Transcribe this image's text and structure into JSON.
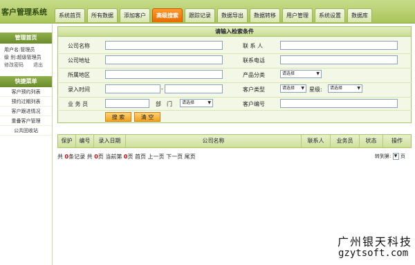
{
  "header": {
    "app_title": "客户管理系统",
    "tabs": [
      "系统首页",
      "所有数据",
      "添加客户",
      "高级搜索",
      "跟踪记录",
      "数据导出",
      "数据转移",
      "用户管理",
      "系统设置",
      "数据库"
    ],
    "active_tab": "高级搜索"
  },
  "sidebar": {
    "section1_title": "管理首页",
    "user_line1": "用户名:管理员",
    "user_line2": "级 别:超级管理员",
    "change_password": "修改密码",
    "logout": "退出",
    "section2_title": "快捷菜单",
    "items": [
      "客户预约列表",
      "预约过期列表",
      "客户跟进情况",
      "重叠客户管理",
      "公共回收站"
    ]
  },
  "search": {
    "title": "请输入检索条件",
    "company_name": "公司名称",
    "contact": "联 系 人",
    "company_address": "公司地址",
    "contact_phone": "联系电话",
    "region": "所属地区",
    "product_category": "产品分类",
    "entry_time": "录入时间",
    "date_sep": "-",
    "customer_type": "客户类型",
    "star_level": "星级:",
    "salesman": "业 务 员",
    "dept_label": "部　门",
    "customer_no": "客户编号",
    "select_placeholder": "请选择",
    "search_button": "搜 索",
    "clear_button": "清 空"
  },
  "table": {
    "columns": [
      "保护",
      "编号",
      "录入日期",
      "公司名称",
      "联系人",
      "业务员",
      "状态",
      "操作"
    ]
  },
  "pager": {
    "prefix": "共",
    "count": "0",
    "records": "条记录 共",
    "pages": "0",
    "pages_suffix": "页 当前第",
    "current": "0",
    "current_suffix": "页 首页 上一页 下一页 尾页",
    "jump_label": "转到第:",
    "jump_suffix": "页"
  },
  "watermark": {
    "company": "广州银天科技",
    "site": "gzytsoft.com"
  }
}
